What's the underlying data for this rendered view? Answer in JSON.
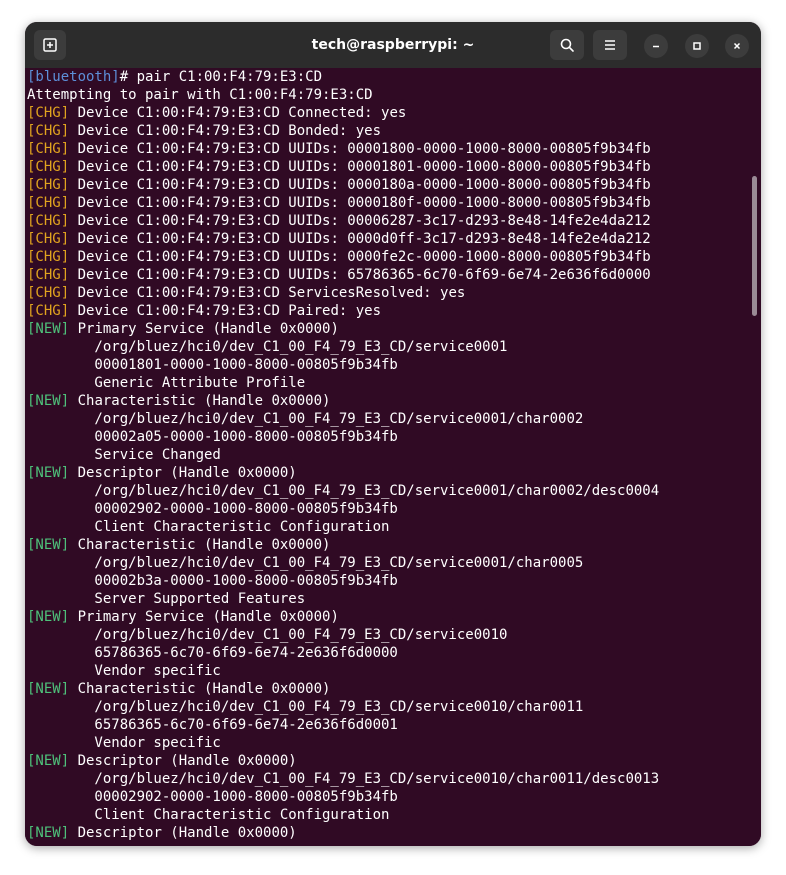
{
  "window": {
    "title": "tech@raspberrypi: ~",
    "icons": {
      "new_tab": "new-tab-icon",
      "search": "search-icon",
      "menu": "hamburger-menu-icon",
      "minimize": "minimize-icon",
      "maximize": "maximize-icon",
      "close": "close-icon"
    }
  },
  "colors": {
    "terminal_bg": "#300a24",
    "prompt": "#5d8fd8",
    "chg": "#e0a31f",
    "new": "#4ec07a",
    "text": "#ffffff"
  },
  "terminal": {
    "lines": [
      {
        "tag": "[bluetooth]",
        "tag_type": "prompt",
        "text": "# pair C1:00:F4:79:E3:CD"
      },
      {
        "tag": "",
        "tag_type": "",
        "text": "Attempting to pair with C1:00:F4:79:E3:CD"
      },
      {
        "tag": "[CHG]",
        "tag_type": "chg",
        "text": " Device C1:00:F4:79:E3:CD Connected: yes"
      },
      {
        "tag": "[CHG]",
        "tag_type": "chg",
        "text": " Device C1:00:F4:79:E3:CD Bonded: yes"
      },
      {
        "tag": "[CHG]",
        "tag_type": "chg",
        "text": " Device C1:00:F4:79:E3:CD UUIDs: 00001800-0000-1000-8000-00805f9b34fb"
      },
      {
        "tag": "[CHG]",
        "tag_type": "chg",
        "text": " Device C1:00:F4:79:E3:CD UUIDs: 00001801-0000-1000-8000-00805f9b34fb"
      },
      {
        "tag": "[CHG]",
        "tag_type": "chg",
        "text": " Device C1:00:F4:79:E3:CD UUIDs: 0000180a-0000-1000-8000-00805f9b34fb"
      },
      {
        "tag": "[CHG]",
        "tag_type": "chg",
        "text": " Device C1:00:F4:79:E3:CD UUIDs: 0000180f-0000-1000-8000-00805f9b34fb"
      },
      {
        "tag": "[CHG]",
        "tag_type": "chg",
        "text": " Device C1:00:F4:79:E3:CD UUIDs: 00006287-3c17-d293-8e48-14fe2e4da212"
      },
      {
        "tag": "[CHG]",
        "tag_type": "chg",
        "text": " Device C1:00:F4:79:E3:CD UUIDs: 0000d0ff-3c17-d293-8e48-14fe2e4da212"
      },
      {
        "tag": "[CHG]",
        "tag_type": "chg",
        "text": " Device C1:00:F4:79:E3:CD UUIDs: 0000fe2c-0000-1000-8000-00805f9b34fb"
      },
      {
        "tag": "[CHG]",
        "tag_type": "chg",
        "text": " Device C1:00:F4:79:E3:CD UUIDs: 65786365-6c70-6f69-6e74-2e636f6d0000"
      },
      {
        "tag": "[CHG]",
        "tag_type": "chg",
        "text": " Device C1:00:F4:79:E3:CD ServicesResolved: yes"
      },
      {
        "tag": "[CHG]",
        "tag_type": "chg",
        "text": " Device C1:00:F4:79:E3:CD Paired: yes"
      },
      {
        "tag": "[NEW]",
        "tag_type": "new",
        "text": " Primary Service (Handle 0x0000)"
      },
      {
        "tag": "",
        "tag_type": "",
        "text": "        /org/bluez/hci0/dev_C1_00_F4_79_E3_CD/service0001"
      },
      {
        "tag": "",
        "tag_type": "",
        "text": "        00001801-0000-1000-8000-00805f9b34fb"
      },
      {
        "tag": "",
        "tag_type": "",
        "text": "        Generic Attribute Profile"
      },
      {
        "tag": "[NEW]",
        "tag_type": "new",
        "text": " Characteristic (Handle 0x0000)"
      },
      {
        "tag": "",
        "tag_type": "",
        "text": "        /org/bluez/hci0/dev_C1_00_F4_79_E3_CD/service0001/char0002"
      },
      {
        "tag": "",
        "tag_type": "",
        "text": "        00002a05-0000-1000-8000-00805f9b34fb"
      },
      {
        "tag": "",
        "tag_type": "",
        "text": "        Service Changed"
      },
      {
        "tag": "[NEW]",
        "tag_type": "new",
        "text": " Descriptor (Handle 0x0000)"
      },
      {
        "tag": "",
        "tag_type": "",
        "text": "        /org/bluez/hci0/dev_C1_00_F4_79_E3_CD/service0001/char0002/desc0004"
      },
      {
        "tag": "",
        "tag_type": "",
        "text": "        00002902-0000-1000-8000-00805f9b34fb"
      },
      {
        "tag": "",
        "tag_type": "",
        "text": "        Client Characteristic Configuration"
      },
      {
        "tag": "[NEW]",
        "tag_type": "new",
        "text": " Characteristic (Handle 0x0000)"
      },
      {
        "tag": "",
        "tag_type": "",
        "text": "        /org/bluez/hci0/dev_C1_00_F4_79_E3_CD/service0001/char0005"
      },
      {
        "tag": "",
        "tag_type": "",
        "text": "        00002b3a-0000-1000-8000-00805f9b34fb"
      },
      {
        "tag": "",
        "tag_type": "",
        "text": "        Server Supported Features"
      },
      {
        "tag": "[NEW]",
        "tag_type": "new",
        "text": " Primary Service (Handle 0x0000)"
      },
      {
        "tag": "",
        "tag_type": "",
        "text": "        /org/bluez/hci0/dev_C1_00_F4_79_E3_CD/service0010"
      },
      {
        "tag": "",
        "tag_type": "",
        "text": "        65786365-6c70-6f69-6e74-2e636f6d0000"
      },
      {
        "tag": "",
        "tag_type": "",
        "text": "        Vendor specific"
      },
      {
        "tag": "[NEW]",
        "tag_type": "new",
        "text": " Characteristic (Handle 0x0000)"
      },
      {
        "tag": "",
        "tag_type": "",
        "text": "        /org/bluez/hci0/dev_C1_00_F4_79_E3_CD/service0010/char0011"
      },
      {
        "tag": "",
        "tag_type": "",
        "text": "        65786365-6c70-6f69-6e74-2e636f6d0001"
      },
      {
        "tag": "",
        "tag_type": "",
        "text": "        Vendor specific"
      },
      {
        "tag": "[NEW]",
        "tag_type": "new",
        "text": " Descriptor (Handle 0x0000)"
      },
      {
        "tag": "",
        "tag_type": "",
        "text": "        /org/bluez/hci0/dev_C1_00_F4_79_E3_CD/service0010/char0011/desc0013"
      },
      {
        "tag": "",
        "tag_type": "",
        "text": "        00002902-0000-1000-8000-00805f9b34fb"
      },
      {
        "tag": "",
        "tag_type": "",
        "text": "        Client Characteristic Configuration"
      },
      {
        "tag": "[NEW]",
        "tag_type": "new",
        "text": " Descriptor (Handle 0x0000)"
      }
    ]
  }
}
